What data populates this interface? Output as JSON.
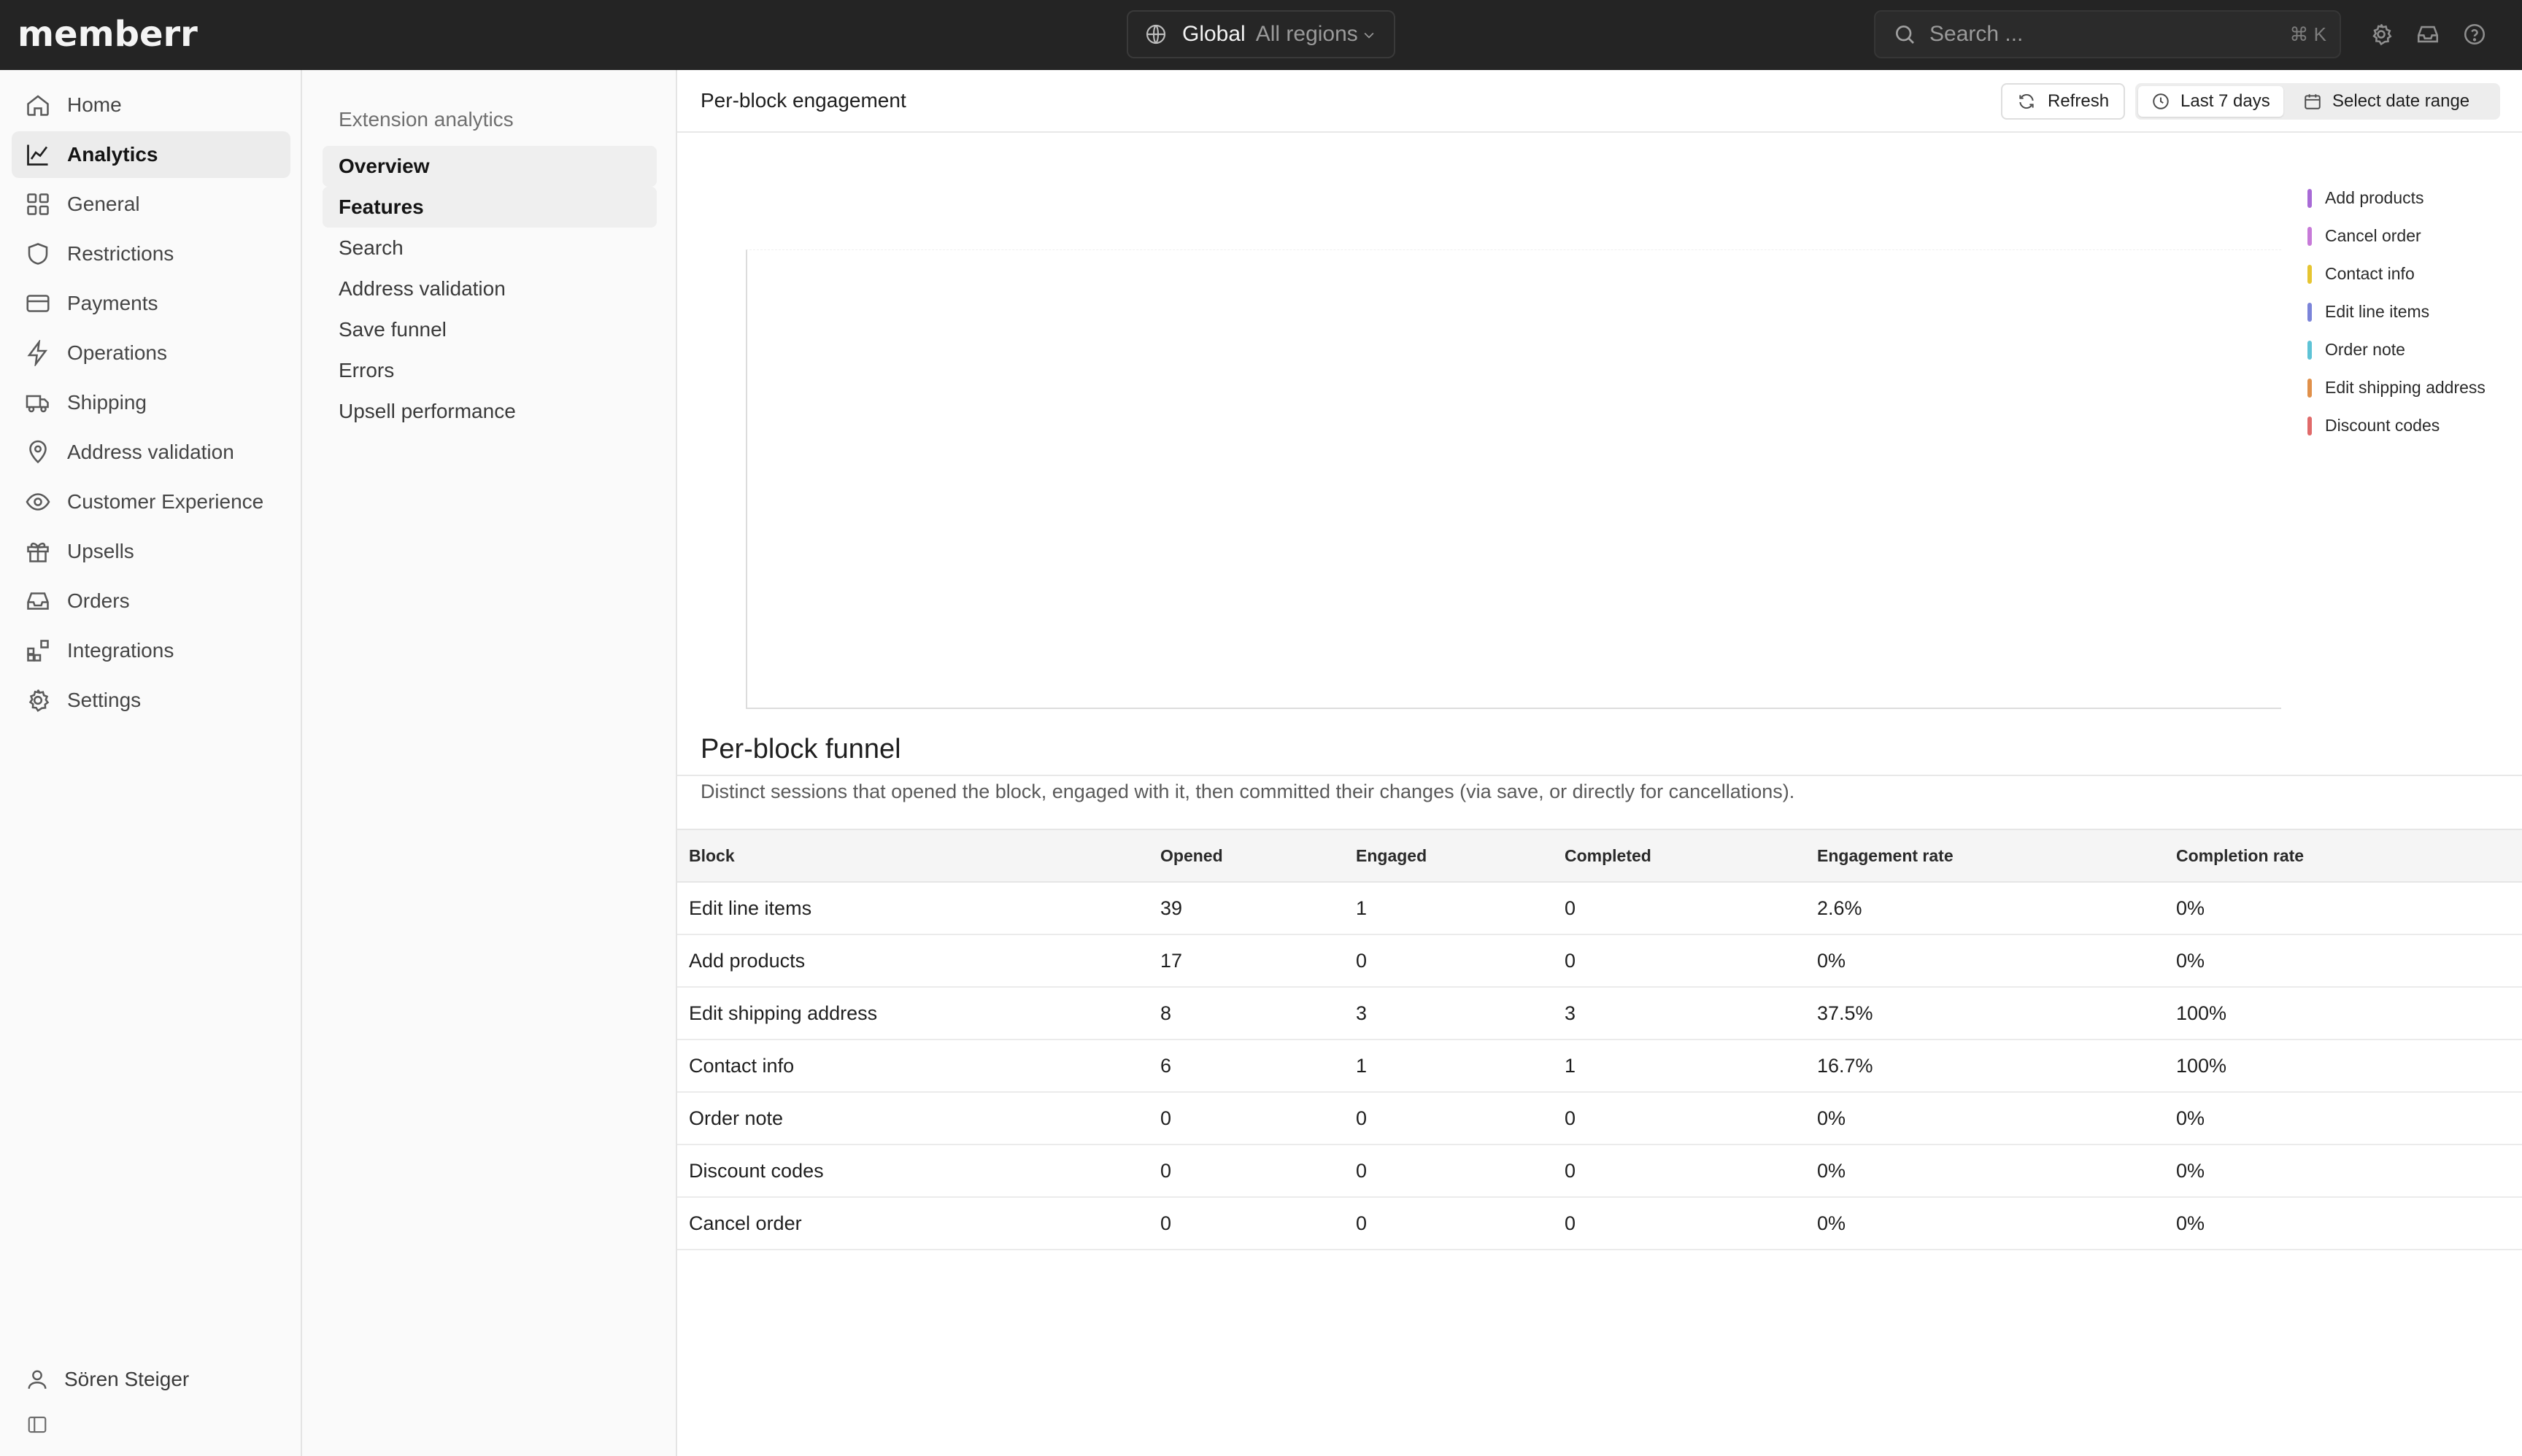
{
  "app": {
    "logo": "memberr"
  },
  "topbar": {
    "region_main": "Global",
    "region_sub": "All regions",
    "search_placeholder": "Search ...",
    "search_shortcut": "⌘ K"
  },
  "sidebar": {
    "items": [
      {
        "label": "Home",
        "icon": "home-icon"
      },
      {
        "label": "Analytics",
        "icon": "chart-line-icon",
        "active": true
      },
      {
        "label": "General",
        "icon": "grid-icon"
      },
      {
        "label": "Restrictions",
        "icon": "shield-icon"
      },
      {
        "label": "Payments",
        "icon": "credit-card-icon"
      },
      {
        "label": "Operations",
        "icon": "bolt-icon"
      },
      {
        "label": "Shipping",
        "icon": "truck-icon"
      },
      {
        "label": "Address validation",
        "icon": "map-pin-icon"
      },
      {
        "label": "Customer Experience",
        "icon": "eye-icon"
      },
      {
        "label": "Upsells",
        "icon": "gift-icon"
      },
      {
        "label": "Orders",
        "icon": "inbox-icon"
      },
      {
        "label": "Integrations",
        "icon": "blocks-icon"
      },
      {
        "label": "Settings",
        "icon": "gear-icon"
      }
    ],
    "user_name": "Sören Steiger"
  },
  "subnav": {
    "title": "Extension analytics",
    "items": [
      {
        "label": "Overview",
        "bold": true
      },
      {
        "label": "Features",
        "bold": true
      },
      {
        "label": "Search"
      },
      {
        "label": "Address validation"
      },
      {
        "label": "Save funnel"
      },
      {
        "label": "Errors"
      },
      {
        "label": "Upsell performance"
      }
    ]
  },
  "main": {
    "header_title": "Per-block engagement",
    "refresh_label": "Refresh",
    "range_active": "Last 7 days",
    "range_select": "Select date range",
    "funnel_title": "Per-block funnel",
    "funnel_desc": "Distinct sessions that opened the block, engaged with it, then committed their changes (via save, or directly for cancellations)."
  },
  "chart_data": {
    "type": "line",
    "series": [
      {
        "name": "Add products",
        "color": "#a86ad6",
        "values": []
      },
      {
        "name": "Cancel order",
        "color": "#c77ad8",
        "values": []
      },
      {
        "name": "Contact info",
        "color": "#e6c531",
        "values": []
      },
      {
        "name": "Edit line items",
        "color": "#7b84d9",
        "values": []
      },
      {
        "name": "Order note",
        "color": "#5ec3d6",
        "values": []
      },
      {
        "name": "Edit shipping address",
        "color": "#e0904a",
        "values": []
      },
      {
        "name": "Discount codes",
        "color": "#e06a6a",
        "values": []
      }
    ],
    "legend_position": "right",
    "grid": false
  },
  "table": {
    "columns": [
      "Block",
      "Opened",
      "Engaged",
      "Completed",
      "Engagement rate",
      "Completion rate"
    ],
    "rows": [
      [
        "Edit line items",
        "39",
        "1",
        "0",
        "2.6%",
        "0%"
      ],
      [
        "Add products",
        "17",
        "0",
        "0",
        "0%",
        "0%"
      ],
      [
        "Edit shipping address",
        "8",
        "3",
        "3",
        "37.5%",
        "100%"
      ],
      [
        "Contact info",
        "6",
        "1",
        "1",
        "16.7%",
        "100%"
      ],
      [
        "Order note",
        "0",
        "0",
        "0",
        "0%",
        "0%"
      ],
      [
        "Discount codes",
        "0",
        "0",
        "0",
        "0%",
        "0%"
      ],
      [
        "Cancel order",
        "0",
        "0",
        "0",
        "0%",
        "0%"
      ]
    ]
  }
}
